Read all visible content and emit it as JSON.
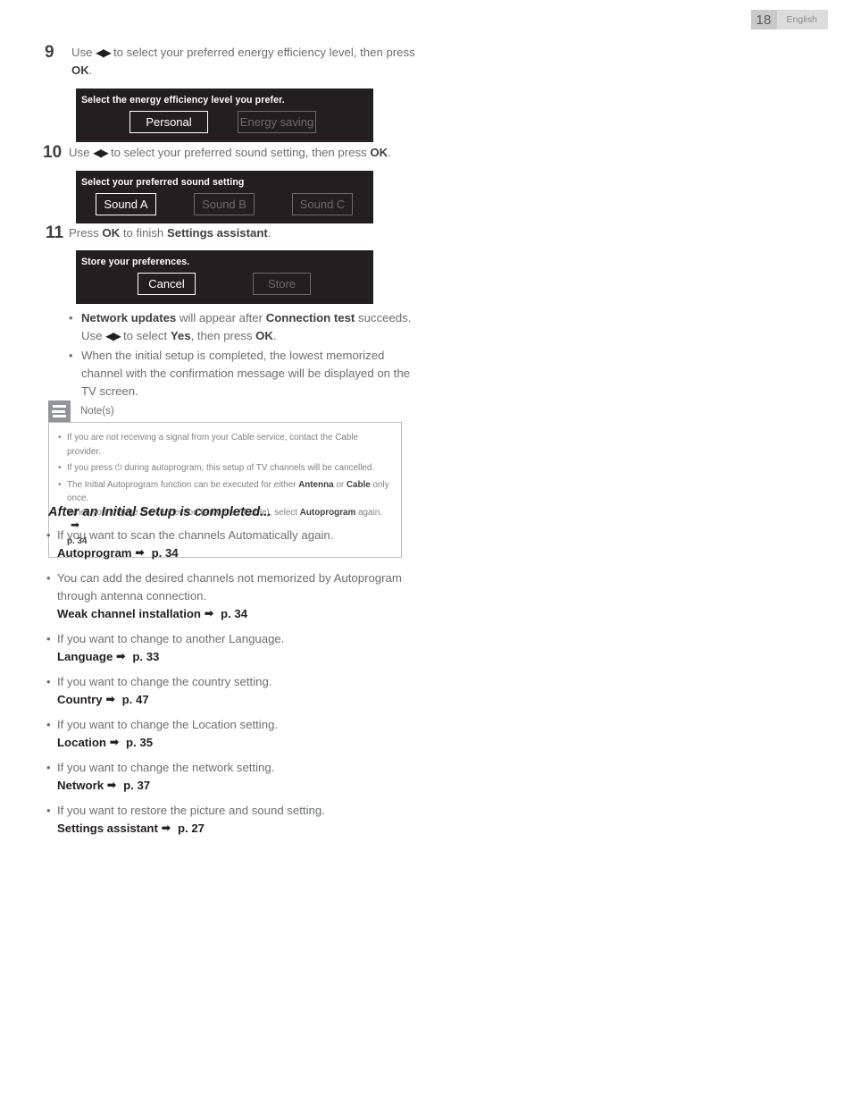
{
  "header": {
    "page_number": "18",
    "language": "English"
  },
  "steps": [
    {
      "number": "9",
      "text_before": "Use ",
      "arrows": "◀▶",
      "text_after": " to select your preferred energy efficiency level, then press ",
      "bold_tail": "OK",
      "period": "."
    },
    {
      "number": "10",
      "text_before": "Use ",
      "arrows": "◀▶",
      "text_after": " to select your preferred sound setting, then press ",
      "bold_tail": "OK",
      "period": "."
    },
    {
      "number": "11",
      "text_before": "Press ",
      "bold_mid": "OK",
      "text_after": " to finish ",
      "bold_tail": "Settings assistant",
      "period": "."
    }
  ],
  "dialogs": [
    {
      "title": "Select the energy efficiency level you prefer.",
      "buttons": [
        {
          "label": "Personal",
          "state": "selected"
        },
        {
          "label": "Energy saving",
          "state": "dimmed"
        }
      ]
    },
    {
      "title": "Select your preferred sound setting",
      "buttons": [
        {
          "label": "Sound A",
          "state": "selected"
        },
        {
          "label": "Sound B",
          "state": "dimmed"
        },
        {
          "label": "Sound C",
          "state": "dimmed"
        }
      ]
    },
    {
      "title": "Store your preferences.",
      "buttons": [
        {
          "label": "Cancel",
          "state": "selected"
        },
        {
          "label": "Store",
          "state": "dimmed"
        }
      ]
    }
  ],
  "post_bullets": {
    "bullet1": {
      "bold1": "Network updates",
      "mid1": " will appear after ",
      "bold2": "Connection test",
      "mid2": " succeeds.",
      "line2_pre": "Use ",
      "arrows": "◀▶",
      "line2_mid": " to select ",
      "bold3": "Yes",
      "line2_mid2": ", then press ",
      "bold4": "OK",
      "line2_end": "."
    },
    "bullet2": {
      "text": "When the initial setup is completed, the lowest memorized channel with the confirmation message will be displayed on the TV screen."
    }
  },
  "notes": {
    "label": "Note(s)",
    "icon": "note-lines-icon",
    "items": [
      {
        "text": "If you are not receiving a signal from your Cable service, contact the Cable provider."
      },
      {
        "pre": "If you press ",
        "symbol": "⏻",
        "post": " during autoprogram, this setup of TV channels will be cancelled."
      },
      {
        "pre": "The Initial Autoprogram function can be executed for either ",
        "bold1": "Antenna",
        "mid1": " or ",
        "bold2": "Cable",
        "mid2": " only once.",
        "line2_pre": "When you change the connection (Antenna / Cable), select ",
        "bold3": "Autoprogram",
        "line2_post": " again. ",
        "arrow": "➡",
        "page_ref": "p. 34"
      }
    ]
  },
  "after_setup": {
    "heading": "After an Initial Setup is completed...",
    "items": [
      {
        "description": "If you want to scan the channels Automatically again.",
        "ref_label": "Autoprogram",
        "arrow": "➡",
        "page": "p. 34"
      },
      {
        "description": "You can add the desired channels not memorized by Autoprogram through antenna connection.",
        "ref_label": "Weak channel installation",
        "arrow": "➡",
        "page": "p. 34"
      },
      {
        "description": "If you want to change to another Language.",
        "ref_label": "Language",
        "arrow": "➡",
        "page": "p. 33"
      },
      {
        "description": "If you want to change the country setting.",
        "ref_label": "Country",
        "arrow": "➡",
        "page": "p. 47"
      },
      {
        "description": "If you want to change the Location setting.",
        "ref_label": "Location",
        "arrow": "➡",
        "page": "p. 35"
      },
      {
        "description": "If you want to change the network setting.",
        "ref_label": "Network",
        "arrow": "➡",
        "page": "p. 37"
      },
      {
        "description": "If you want to restore the picture and sound setting.",
        "ref_label": "Settings assistant",
        "arrow": "➡",
        "page": "p. 27"
      }
    ]
  },
  "bullet_char": "•"
}
